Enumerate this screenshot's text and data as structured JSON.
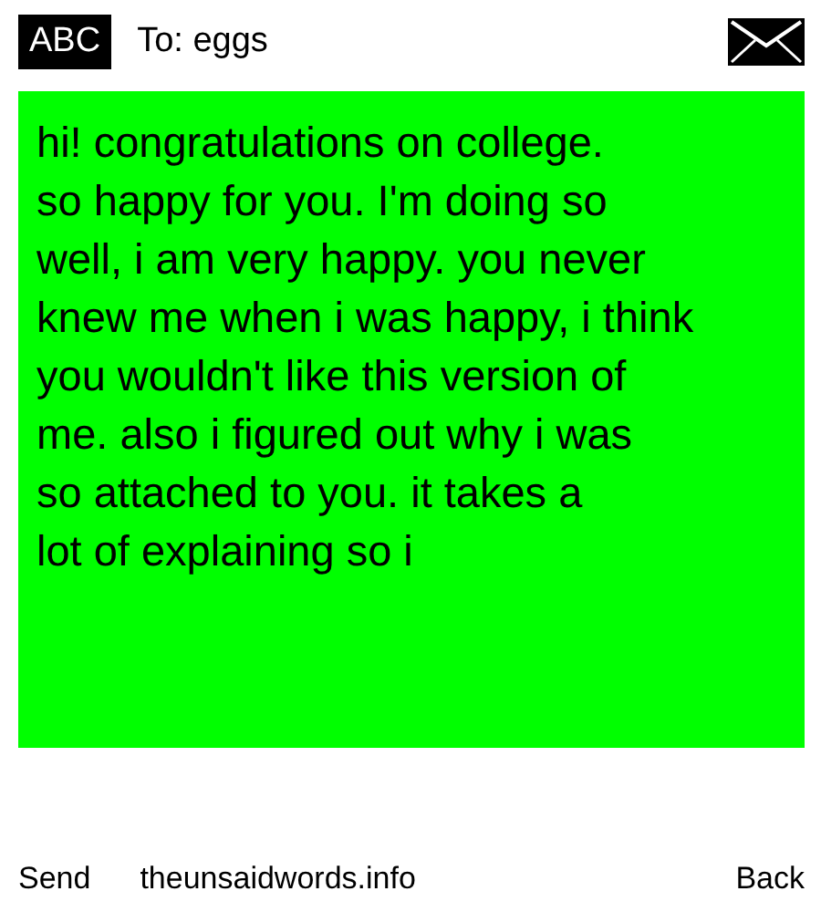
{
  "header": {
    "badge": "ABC",
    "recipient": "To: eggs"
  },
  "message": {
    "text": "hi! congratulations on college.\nso happy for you. I'm doing so\nwell, i am very happy. you never\nknew me when i was happy, i think\nyou wouldn't like this version of\nme. also i figured out why i was\nso attached to you. it takes a\nlot of explaining so i"
  },
  "footer": {
    "left": "Send",
    "center": "theunsaidwords.info",
    "right": "Back"
  }
}
